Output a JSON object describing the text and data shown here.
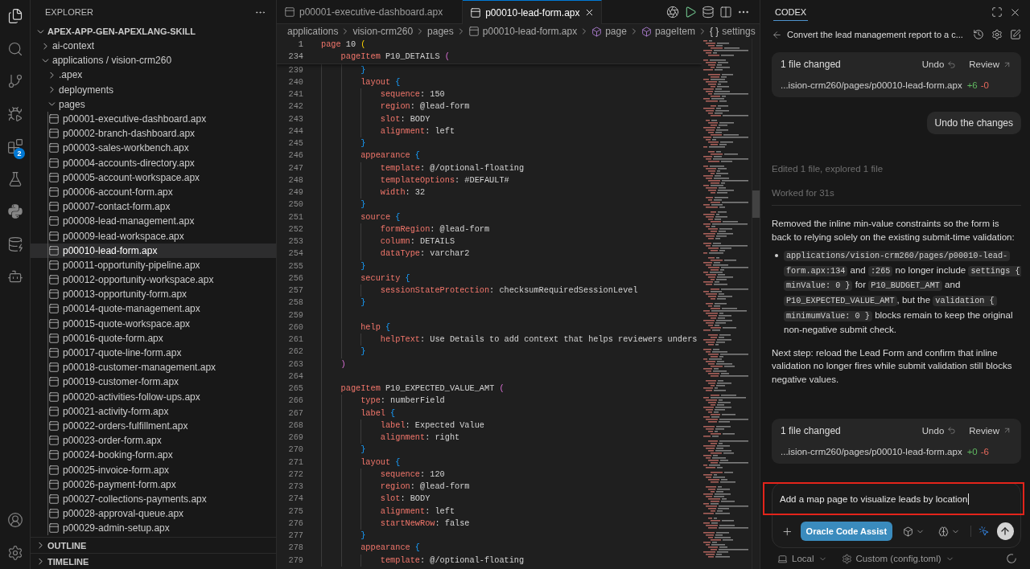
{
  "activity_bar": {
    "items": [
      {
        "kind": "explorer",
        "selected": true
      },
      {
        "kind": "search",
        "selected": false
      },
      {
        "kind": "source-control",
        "selected": false
      },
      {
        "kind": "run-debug",
        "selected": false
      },
      {
        "kind": "extensions",
        "selected": false,
        "badge": "2"
      },
      {
        "kind": "testing",
        "selected": false
      },
      {
        "kind": "python",
        "selected": false
      },
      {
        "kind": "database",
        "selected": false
      },
      {
        "kind": "assistant",
        "selected": false
      }
    ],
    "bottom_items": [
      {
        "kind": "accounts",
        "selected": false
      },
      {
        "kind": "manage",
        "selected": false
      }
    ]
  },
  "sidebar": {
    "title": "EXPLORER",
    "sections": [
      {
        "title": "APEX-APP-GEN-APEXLANG-SKILL",
        "expanded": true,
        "tree": [
          {
            "kind": "folder",
            "label": "ai-context",
            "expanded": false,
            "selected": false
          },
          {
            "kind": "folder",
            "label": "applications / vision-crm260",
            "expanded": true,
            "selected": false,
            "children": [
              {
                "kind": "folder",
                "label": ".apex",
                "expanded": false,
                "selected": false
              },
              {
                "kind": "folder",
                "label": "deployments",
                "expanded": false,
                "selected": false
              },
              {
                "kind": "folder",
                "label": "pages",
                "expanded": true,
                "selected": false,
                "children": [
                  {
                    "kind": "file",
                    "label": "p00001-executive-dashboard.apx",
                    "selected": false
                  },
                  {
                    "kind": "file",
                    "label": "p00002-branch-dashboard.apx",
                    "selected": false
                  },
                  {
                    "kind": "file",
                    "label": "p00003-sales-workbench.apx",
                    "selected": false
                  },
                  {
                    "kind": "file",
                    "label": "p00004-accounts-directory.apx",
                    "selected": false
                  },
                  {
                    "kind": "file",
                    "label": "p00005-account-workspace.apx",
                    "selected": false
                  },
                  {
                    "kind": "file",
                    "label": "p00006-account-form.apx",
                    "selected": false
                  },
                  {
                    "kind": "file",
                    "label": "p00007-contact-form.apx",
                    "selected": false
                  },
                  {
                    "kind": "file",
                    "label": "p00008-lead-management.apx",
                    "selected": false
                  },
                  {
                    "kind": "file",
                    "label": "p00009-lead-workspace.apx",
                    "selected": false
                  },
                  {
                    "kind": "file",
                    "label": "p00010-lead-form.apx",
                    "selected": true
                  },
                  {
                    "kind": "file",
                    "label": "p00011-opportunity-pipeline.apx",
                    "selected": false
                  },
                  {
                    "kind": "file",
                    "label": "p00012-opportunity-workspace.apx",
                    "selected": false
                  },
                  {
                    "kind": "file",
                    "label": "p00013-opportunity-form.apx",
                    "selected": false
                  },
                  {
                    "kind": "file",
                    "label": "p00014-quote-management.apx",
                    "selected": false
                  },
                  {
                    "kind": "file",
                    "label": "p00015-quote-workspace.apx",
                    "selected": false
                  },
                  {
                    "kind": "file",
                    "label": "p00016-quote-form.apx",
                    "selected": false
                  },
                  {
                    "kind": "file",
                    "label": "p00017-quote-line-form.apx",
                    "selected": false
                  },
                  {
                    "kind": "file",
                    "label": "p00018-customer-management.apx",
                    "selected": false
                  },
                  {
                    "kind": "file",
                    "label": "p00019-customer-form.apx",
                    "selected": false
                  },
                  {
                    "kind": "file",
                    "label": "p00020-activities-follow-ups.apx",
                    "selected": false
                  },
                  {
                    "kind": "file",
                    "label": "p00021-activity-form.apx",
                    "selected": false
                  },
                  {
                    "kind": "file",
                    "label": "p00022-orders-fulfillment.apx",
                    "selected": false
                  },
                  {
                    "kind": "file",
                    "label": "p00023-order-form.apx",
                    "selected": false
                  },
                  {
                    "kind": "file",
                    "label": "p00024-booking-form.apx",
                    "selected": false
                  },
                  {
                    "kind": "file",
                    "label": "p00025-invoice-form.apx",
                    "selected": false
                  },
                  {
                    "kind": "file",
                    "label": "p00026-payment-form.apx",
                    "selected": false
                  },
                  {
                    "kind": "file",
                    "label": "p00027-collections-payments.apx",
                    "selected": false
                  },
                  {
                    "kind": "file",
                    "label": "p00028-approval-queue.apx",
                    "selected": false
                  },
                  {
                    "kind": "file",
                    "label": "p00029-admin-setup.apx",
                    "selected": false
                  }
                ]
              }
            ]
          }
        ]
      },
      {
        "title": "OUTLINE",
        "expanded": false
      },
      {
        "title": "TIMELINE",
        "expanded": false
      }
    ]
  },
  "editor": {
    "tabs": [
      {
        "label": "p00001-executive-dashboard.apx",
        "selected": false
      },
      {
        "label": "p00010-lead-form.apx",
        "selected": true
      }
    ],
    "breadcrumb": [
      {
        "kind": "folder",
        "label": "applications"
      },
      {
        "kind": "folder",
        "label": "vision-crm260"
      },
      {
        "kind": "folder",
        "label": "pages"
      },
      {
        "kind": "file",
        "label": "p00010-lead-form.apx"
      },
      {
        "kind": "symbol",
        "label": "page"
      },
      {
        "kind": "symbol",
        "label": "pageItem"
      },
      {
        "kind": "braces",
        "glyph": "{ }",
        "label": "settings"
      }
    ],
    "sticky_lines": [
      {
        "number": "1",
        "tokens": [
          {
            "kind": "key",
            "text": "page"
          },
          {
            "kind": "plain",
            "text": " 10 "
          },
          {
            "kind": "bracket-1",
            "text": "("
          }
        ]
      },
      {
        "number": "234",
        "tokens": [
          {
            "kind": "key",
            "text": "    pageItem"
          },
          {
            "kind": "plain",
            "text": " P10_DETAILS "
          },
          {
            "kind": "bracket-2",
            "text": "("
          }
        ]
      }
    ],
    "lines": [
      {
        "number": "239",
        "tokens": [
          {
            "kind": "bracket-3",
            "text": "        }"
          }
        ]
      },
      {
        "number": "240",
        "tokens": [
          {
            "kind": "key",
            "text": "        layout"
          },
          {
            "kind": "bracket-3",
            "text": " {"
          }
        ]
      },
      {
        "number": "241",
        "tokens": [
          {
            "kind": "key",
            "text": "            sequence"
          },
          {
            "kind": "plain",
            "text": ": 150"
          }
        ]
      },
      {
        "number": "242",
        "tokens": [
          {
            "kind": "key",
            "text": "            region"
          },
          {
            "kind": "plain",
            "text": ": @lead-form"
          }
        ]
      },
      {
        "number": "243",
        "tokens": [
          {
            "kind": "key",
            "text": "            slot"
          },
          {
            "kind": "plain",
            "text": ": BODY"
          }
        ]
      },
      {
        "number": "244",
        "tokens": [
          {
            "kind": "key",
            "text": "            alignment"
          },
          {
            "kind": "plain",
            "text": ": left"
          }
        ]
      },
      {
        "number": "245",
        "tokens": [
          {
            "kind": "bracket-3",
            "text": "        }"
          }
        ]
      },
      {
        "number": "246",
        "tokens": [
          {
            "kind": "key",
            "text": "        appearance"
          },
          {
            "kind": "bracket-3",
            "text": " {"
          }
        ]
      },
      {
        "number": "247",
        "tokens": [
          {
            "kind": "key",
            "text": "            template"
          },
          {
            "kind": "plain",
            "text": ": @/optional-floating"
          }
        ]
      },
      {
        "number": "248",
        "tokens": [
          {
            "kind": "key",
            "text": "            templateOptions"
          },
          {
            "kind": "plain",
            "text": ": #DEFAULT#"
          }
        ]
      },
      {
        "number": "249",
        "tokens": [
          {
            "kind": "key",
            "text": "            width"
          },
          {
            "kind": "plain",
            "text": ": 32"
          }
        ]
      },
      {
        "number": "250",
        "tokens": [
          {
            "kind": "bracket-3",
            "text": "        }"
          }
        ]
      },
      {
        "number": "251",
        "tokens": [
          {
            "kind": "key",
            "text": "        source"
          },
          {
            "kind": "bracket-3",
            "text": " {"
          }
        ]
      },
      {
        "number": "252",
        "tokens": [
          {
            "kind": "key",
            "text": "            formRegion"
          },
          {
            "kind": "plain",
            "text": ": @lead-form"
          }
        ]
      },
      {
        "number": "253",
        "tokens": [
          {
            "kind": "key",
            "text": "            column"
          },
          {
            "kind": "plain",
            "text": ": DETAILS"
          }
        ]
      },
      {
        "number": "254",
        "tokens": [
          {
            "kind": "key",
            "text": "            dataType"
          },
          {
            "kind": "plain",
            "text": ": varchar2"
          }
        ]
      },
      {
        "number": "255",
        "tokens": [
          {
            "kind": "bracket-3",
            "text": "        }"
          }
        ]
      },
      {
        "number": "256",
        "tokens": [
          {
            "kind": "key",
            "text": "        security"
          },
          {
            "kind": "bracket-3",
            "text": " {"
          }
        ]
      },
      {
        "number": "257",
        "tokens": [
          {
            "kind": "key",
            "text": "            sessionStateProtection"
          },
          {
            "kind": "plain",
            "text": ": checksumRequiredSessionLevel"
          }
        ]
      },
      {
        "number": "258",
        "tokens": [
          {
            "kind": "bracket-3",
            "text": "        }"
          }
        ]
      },
      {
        "number": "259"
      },
      {
        "number": "260",
        "tokens": [
          {
            "kind": "key",
            "text": "        help"
          },
          {
            "kind": "bracket-3",
            "text": " {"
          }
        ]
      },
      {
        "number": "261",
        "tokens": [
          {
            "kind": "key",
            "text": "            helpText"
          },
          {
            "kind": "plain",
            "text": ": Use Details to add context that helps reviewers unders"
          }
        ]
      },
      {
        "number": "262",
        "tokens": [
          {
            "kind": "bracket-3",
            "text": "        }"
          }
        ]
      },
      {
        "number": "263",
        "tokens": [
          {
            "kind": "bracket-2",
            "text": "    )"
          }
        ]
      },
      {
        "number": "264"
      },
      {
        "number": "265",
        "tokens": [
          {
            "kind": "key",
            "text": "    pageItem"
          },
          {
            "kind": "plain",
            "text": " P10_EXPECTED_VALUE_AMT "
          },
          {
            "kind": "bracket-2",
            "text": "("
          }
        ]
      },
      {
        "number": "266",
        "tokens": [
          {
            "kind": "key",
            "text": "        type"
          },
          {
            "kind": "plain",
            "text": ": numberField"
          }
        ]
      },
      {
        "number": "267",
        "tokens": [
          {
            "kind": "key",
            "text": "        label"
          },
          {
            "kind": "bracket-3",
            "text": " {"
          }
        ]
      },
      {
        "number": "268",
        "tokens": [
          {
            "kind": "key",
            "text": "            label"
          },
          {
            "kind": "plain",
            "text": ": Expected Value"
          }
        ]
      },
      {
        "number": "269",
        "tokens": [
          {
            "kind": "key",
            "text": "            alignment"
          },
          {
            "kind": "plain",
            "text": ": right"
          }
        ]
      },
      {
        "number": "270",
        "tokens": [
          {
            "kind": "bracket-3",
            "text": "        }"
          }
        ]
      },
      {
        "number": "271",
        "tokens": [
          {
            "kind": "key",
            "text": "        layout"
          },
          {
            "kind": "bracket-3",
            "text": " {"
          }
        ]
      },
      {
        "number": "272",
        "tokens": [
          {
            "kind": "key",
            "text": "            sequence"
          },
          {
            "kind": "plain",
            "text": ": 120"
          }
        ]
      },
      {
        "number": "273",
        "tokens": [
          {
            "kind": "key",
            "text": "            region"
          },
          {
            "kind": "plain",
            "text": ": @lead-form"
          }
        ]
      },
      {
        "number": "274",
        "tokens": [
          {
            "kind": "key",
            "text": "            slot"
          },
          {
            "kind": "plain",
            "text": ": BODY"
          }
        ]
      },
      {
        "number": "275",
        "tokens": [
          {
            "kind": "key",
            "text": "            alignment"
          },
          {
            "kind": "plain",
            "text": ": left"
          }
        ]
      },
      {
        "number": "276",
        "tokens": [
          {
            "kind": "key",
            "text": "            startNewRow"
          },
          {
            "kind": "plain",
            "text": ": false"
          }
        ]
      },
      {
        "number": "277",
        "tokens": [
          {
            "kind": "bracket-3",
            "text": "        }"
          }
        ]
      },
      {
        "number": "278",
        "tokens": [
          {
            "kind": "key",
            "text": "        appearance"
          },
          {
            "kind": "bracket-3",
            "text": " {"
          }
        ]
      },
      {
        "number": "279",
        "tokens": [
          {
            "kind": "key",
            "text": "            template"
          },
          {
            "kind": "plain",
            "text": ": @/optional-floating"
          }
        ]
      }
    ]
  },
  "codex": {
    "title": "CODEX",
    "thread_title": "Convert the lead management report to a c...",
    "messages": [
      {
        "kind": "changes",
        "summary": "1 file changed",
        "undo": "Undo",
        "review": "Review",
        "file": "...ision-crm260/pages/p00010-lead-form.apx",
        "added": "+6",
        "removed": "-0"
      },
      {
        "kind": "user",
        "text": "Undo the changes"
      },
      {
        "kind": "status",
        "text": "Edited 1 file, explored 1 file"
      },
      {
        "kind": "duration",
        "text": "Worked for 31s"
      },
      {
        "kind": "paragraph",
        "segments": [
          {
            "kind": "text",
            "text": "Removed the inline min-value constraints so the form is back to relying solely on the existing submit-time validation:"
          }
        ]
      },
      {
        "kind": "bullet",
        "segments": [
          {
            "kind": "code",
            "text": "applications/vision-crm260/pages/p00010-lead-form.apx:134"
          },
          {
            "kind": "text",
            "text": " and "
          },
          {
            "kind": "code",
            "text": ":265"
          },
          {
            "kind": "text",
            "text": " no longer include "
          },
          {
            "kind": "code",
            "text": "settings { minValue: 0 }"
          },
          {
            "kind": "text",
            "text": " for "
          },
          {
            "kind": "code",
            "text": "P10_BUDGET_AMT"
          },
          {
            "kind": "text",
            "text": " and "
          },
          {
            "kind": "code",
            "text": "P10_EXPECTED_VALUE_AMT"
          },
          {
            "kind": "text",
            "text": ", but the "
          },
          {
            "kind": "code",
            "text": "validation { minimumValue: 0 }"
          },
          {
            "kind": "text",
            "text": " blocks remain to keep the original non-negative submit check."
          }
        ]
      },
      {
        "kind": "paragraph",
        "segments": [
          {
            "kind": "text",
            "text": "Next step: reload the Lead Form and confirm that inline validation no longer fires while submit validation still blocks negative values."
          }
        ]
      },
      {
        "kind": "changes",
        "summary": "1 file changed",
        "undo": "Undo",
        "review": "Review",
        "file": "...ision-crm260/pages/p00010-lead-form.apx",
        "added": "+0",
        "removed": "-6"
      }
    ],
    "composer": {
      "value": "Add a map page to visualize leads by location",
      "highlighted": true,
      "agent": "Oracle Code Assist",
      "footer": [
        {
          "kind": "environment",
          "label": "Local"
        },
        {
          "kind": "config",
          "label": "Custom (config.toml)"
        }
      ]
    }
  }
}
